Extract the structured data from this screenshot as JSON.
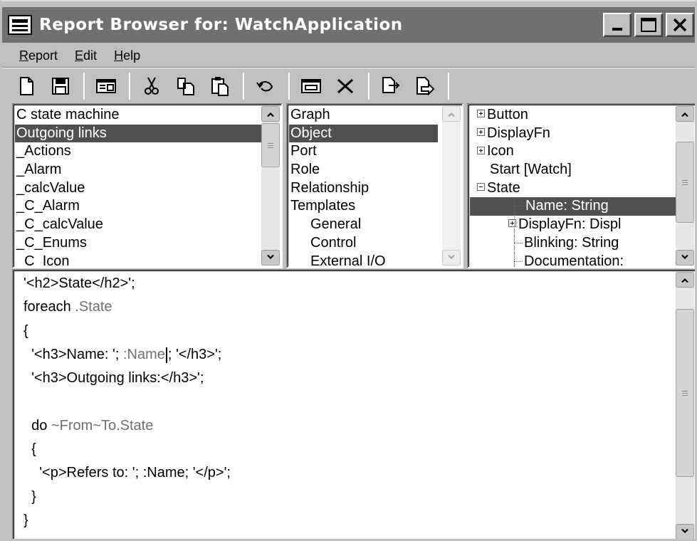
{
  "window": {
    "title": "Report Browser for: WatchApplication"
  },
  "menu": {
    "items": [
      {
        "label": "Report",
        "mnemonic": "R",
        "rest": "eport"
      },
      {
        "label": "Edit",
        "mnemonic": "E",
        "rest": "dit"
      },
      {
        "label": "Help",
        "mnemonic": "H",
        "rest": "elp"
      }
    ]
  },
  "toolbar": {
    "icons": [
      "new-icon",
      "save-icon",
      "properties-icon",
      "cut-icon",
      "copy-icon",
      "paste-icon",
      "undo-icon",
      "run-icon",
      "delete-icon",
      "import-icon",
      "export-icon"
    ]
  },
  "reports_list": {
    "items": [
      "C state machine",
      "Outgoing links",
      "_Actions",
      "_Alarm",
      "_calcValue",
      "_C_Alarm",
      "_C_calcValue",
      "_C_Enums",
      "_C_Icon"
    ],
    "selected_index": 1
  },
  "types_list": {
    "items": [
      "Graph",
      "Object",
      "Port",
      "Role",
      "Relationship",
      "Templates",
      "General",
      "Control",
      "External I/O"
    ],
    "selected_index": 1
  },
  "tree": {
    "items": [
      {
        "label": "Button",
        "state": "collapsed"
      },
      {
        "label": "DisplayFn",
        "state": "collapsed"
      },
      {
        "label": "Icon",
        "state": "collapsed"
      },
      {
        "label": "Start [Watch]",
        "state": "leaf"
      },
      {
        "label": "State",
        "state": "expanded"
      },
      {
        "label": "Name: String",
        "state": "child-selected"
      },
      {
        "label": "DisplayFn: Displ",
        "state": "child-collapsed"
      },
      {
        "label": "Blinking: String",
        "state": "child"
      },
      {
        "label": "Documentation:",
        "state": "child-last"
      }
    ]
  },
  "code": {
    "l1": "'<h2>State</h2>';",
    "l2a": "foreach ",
    "l2b": ".State",
    "l3": "{",
    "l4a": "  '<h3>Name: '; ",
    "l4b": ":Name",
    "l4c": "; '</h3>';",
    "l5": "  '<h3>Outgoing links:</h3>';",
    "l6": "",
    "l7a": "  do ",
    "l7b": "~From~To.State",
    "l8": "  {",
    "l9": "    '<p>Refers to: '; :Name; '</p>';",
    "l10": "  }",
    "l11": "}"
  },
  "colors": {
    "titlebar": "#707070",
    "selection": "#505050",
    "face": "#c0c0c0"
  }
}
